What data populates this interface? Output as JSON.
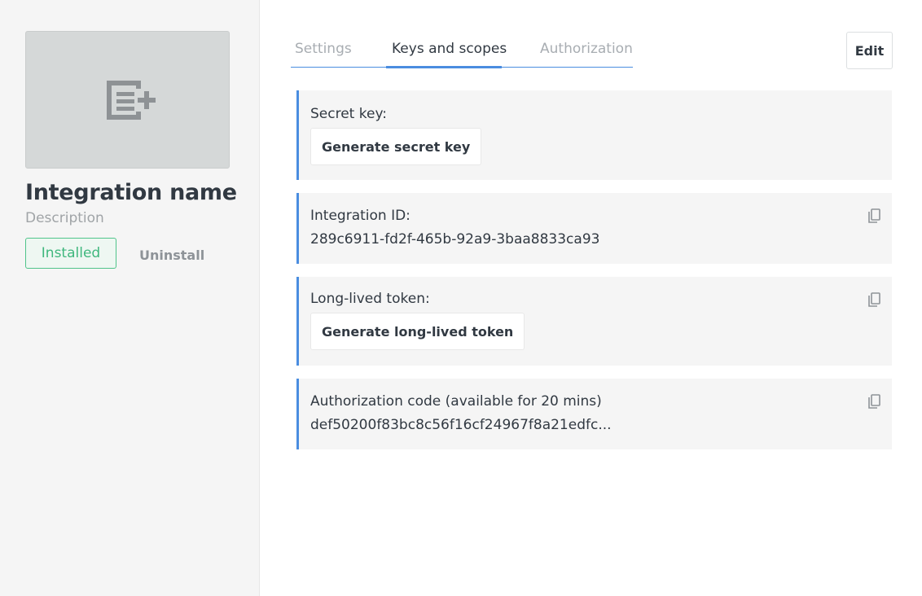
{
  "integration": {
    "name": "Integration name",
    "description": "Description",
    "installed_label": "Installed",
    "uninstall_label": "Uninstall",
    "logo_icon": "add-list-icon"
  },
  "tabs": [
    {
      "label": "Settings",
      "active": false
    },
    {
      "label": "Keys and scopes",
      "active": true
    },
    {
      "label": "Authorization",
      "active": false
    }
  ],
  "toolbar": {
    "edit_label": "Edit"
  },
  "cards": {
    "secret_key": {
      "label": "Secret key:",
      "button": "Generate secret key"
    },
    "integration_id": {
      "label": "Integration ID:",
      "value": "289c6911-fd2f-465b-92a9-3baa8833ca93"
    },
    "long_lived_token": {
      "label": "Long-lived token:",
      "button": "Generate long-lived token"
    },
    "authorization_code": {
      "label": "Authorization code (available for 20 mins)",
      "value": "def50200f83bc8c56f16cf24967f8a21edfc..."
    }
  },
  "colors": {
    "accent": "#4a8de0",
    "installed_green": "#3fb77d",
    "panel_bg": "#f5f5f5"
  }
}
